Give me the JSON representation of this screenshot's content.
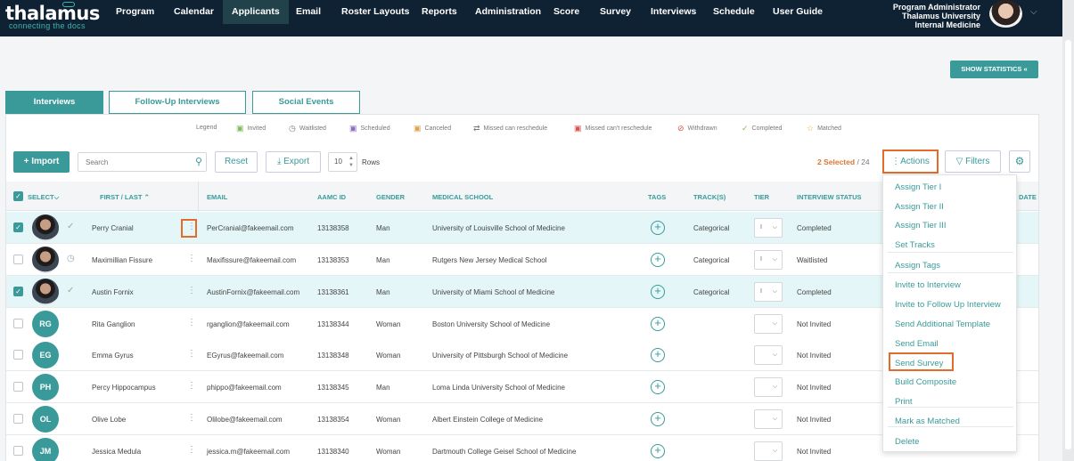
{
  "brand": {
    "name": "thalamus",
    "tagline": "connecting the docs"
  },
  "nav": [
    "Program",
    "Calendar",
    "Applicants",
    "Email",
    "Roster Layouts",
    "Reports",
    "Administration",
    "Score",
    "Survey",
    "Interviews",
    "Schedule",
    "User Guide"
  ],
  "nav_active": "Applicants",
  "user": {
    "role": "Program Administrator",
    "org": "Thalamus University",
    "dept": "Internal Medicine"
  },
  "show_statistics": "SHOW STATISTICS",
  "tabs": [
    "Interviews",
    "Follow-Up Interviews",
    "Social Events"
  ],
  "legend": {
    "title": "Legend",
    "items": [
      "Invited",
      "Waitlisted",
      "Scheduled",
      "Canceled",
      "Missed can reschedule",
      "Missed can't reschedule",
      "Withdrawn",
      "Completed",
      "Matched"
    ]
  },
  "toolbar": {
    "import": "Import",
    "search_placeholder": "Search",
    "reset": "Reset",
    "export": "Export",
    "rows_value": "10",
    "rows_label": "Rows",
    "selected": "2 Selected",
    "total": "/ 24",
    "actions": "Actions",
    "filters": "Filters"
  },
  "columns": {
    "select": "SELECT",
    "name": "FIRST / LAST",
    "email": "EMAIL",
    "aamc": "AAMC ID",
    "gender": "GENDER",
    "school": "MEDICAL SCHOOL",
    "tags": "TAGS",
    "tracks": "TRACK(S)",
    "tier": "TIER",
    "status": "INTERVIEW STATUS",
    "date": "DATE"
  },
  "rows": [
    {
      "name": "Perry Cranial",
      "initials": "",
      "email": "PerCranial@fakeemail.com",
      "aamc": "13138358",
      "gender": "Man",
      "school": "University of Louisville School of Medicine",
      "track": "Categorical",
      "tier": "I",
      "status": "Completed",
      "selected": true,
      "status_icon": "check-icon"
    },
    {
      "name": "Maximillian Fissure",
      "initials": "",
      "email": "Maxifissure@fakeemail.com",
      "aamc": "13138353",
      "gender": "Man",
      "school": "Rutgers New Jersey Medical School",
      "track": "Categorical",
      "tier": "I",
      "status": "Waitlisted",
      "selected": false,
      "status_icon": "clock-icon"
    },
    {
      "name": "Austin Fornix",
      "initials": "",
      "email": "AustinFornix@fakeemail.com",
      "aamc": "13138361",
      "gender": "Man",
      "school": "University of Miami School of Medicine",
      "track": "Categorical",
      "tier": "I",
      "status": "Completed",
      "selected": true,
      "status_icon": "check-icon"
    },
    {
      "name": "Rita Ganglion",
      "initials": "RG",
      "email": "rganglion@fakeemail.com",
      "aamc": "13138344",
      "gender": "Woman",
      "school": "Boston University School of Medicine",
      "track": "",
      "tier": "",
      "status": "Not Invited",
      "selected": false,
      "status_icon": ""
    },
    {
      "name": "Emma Gyrus",
      "initials": "EG",
      "email": "EGyrus@fakeemail.com",
      "aamc": "13138348",
      "gender": "Woman",
      "school": "University of Pittsburgh School of Medicine",
      "track": "",
      "tier": "",
      "status": "Not Invited",
      "selected": false,
      "status_icon": ""
    },
    {
      "name": "Percy Hippocampus",
      "initials": "PH",
      "email": "phippo@fakeemail.com",
      "aamc": "13138345",
      "gender": "Man",
      "school": "Loma Linda University School of Medicine",
      "track": "",
      "tier": "",
      "status": "Not Invited",
      "selected": false,
      "status_icon": ""
    },
    {
      "name": "Olive Lobe",
      "initials": "OL",
      "email": "Olilobe@fakeemail.com",
      "aamc": "13138354",
      "gender": "Woman",
      "school": "Albert Einstein College of Medicine",
      "track": "",
      "tier": "",
      "status": "Not Invited",
      "selected": false,
      "status_icon": ""
    },
    {
      "name": "Jessica Medula",
      "initials": "JM",
      "email": "jessica.m@fakeemail.com",
      "aamc": "13138340",
      "gender": "Woman",
      "school": "Dartmouth College Geisel School of Medicine",
      "track": "",
      "tier": "",
      "status": "Not Invited",
      "selected": false,
      "status_icon": ""
    }
  ],
  "actions_menu": [
    "Assign Tier I",
    "Assign Tier II",
    "Assign Tier III",
    "Set Tracks",
    "Assign Tags",
    "Invite to Interview",
    "Invite to Follow Up Interview",
    "Send Additional Template",
    "Send Email",
    "Send Survey",
    "Build Composite",
    "Print",
    "Mark as Matched",
    "Delete"
  ],
  "accent_color": "#3a9a9a",
  "highlight_color": "#e46b2a"
}
